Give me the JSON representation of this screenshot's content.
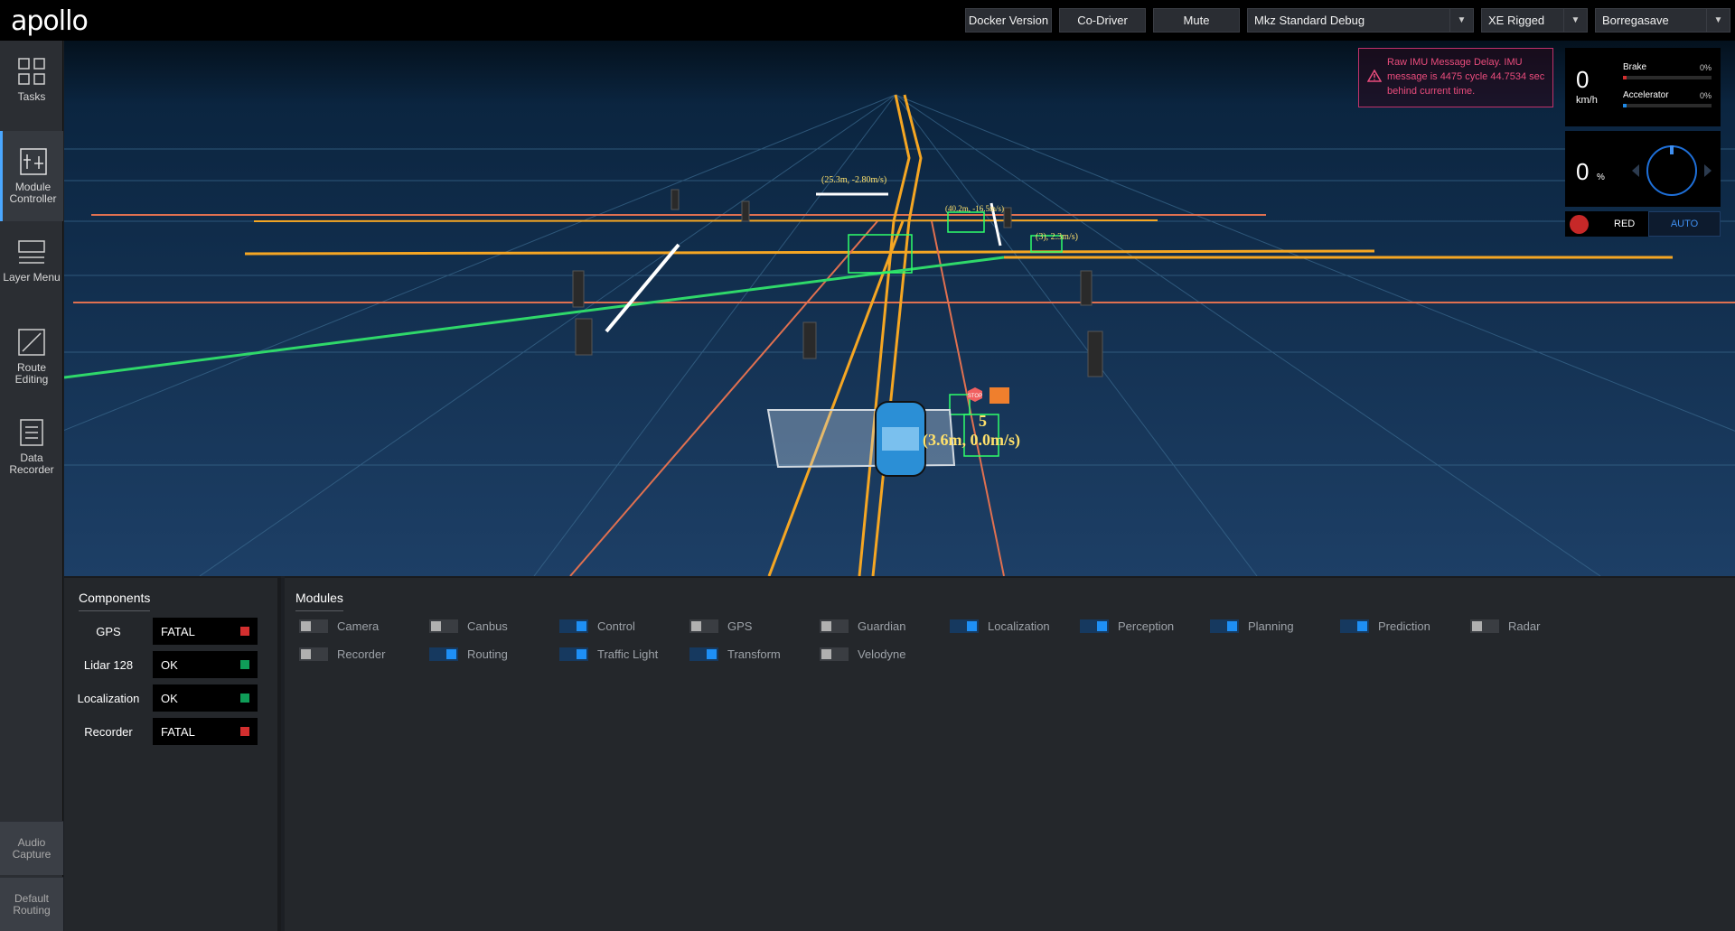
{
  "header": {
    "logo": "apollo",
    "buttons": [
      "Docker Version",
      "Co-Driver",
      "Mute"
    ],
    "vehicle_mode": "Mkz Standard Debug",
    "vehicle": "XE Rigged",
    "map": "Borregasave"
  },
  "sidebar": {
    "items": [
      {
        "label": "Tasks",
        "icon": "grid-icon"
      },
      {
        "label": "Module Controller",
        "icon": "module-controller-icon",
        "active": true
      },
      {
        "label": "Layer Menu",
        "icon": "layers-icon"
      },
      {
        "label": "Route Editing",
        "icon": "route-edit-icon"
      },
      {
        "label": "Data Recorder",
        "icon": "data-recorder-icon"
      }
    ],
    "bottom": [
      "Audio Capture",
      "Default Routing"
    ]
  },
  "alert": {
    "text": "Raw IMU Message Delay. IMU message is 4475 cycle 44.7534 sec behind current time.",
    "color": "#ea4c7c"
  },
  "dashboard": {
    "speed": "0",
    "speed_unit": "km/h",
    "brake_label": "Brake",
    "brake_pct": "0%",
    "accel_label": "Accelerator",
    "accel_pct": "0%",
    "steering": "0",
    "steering_unit": "%",
    "traffic_light": "RED",
    "driving_mode": "AUTO"
  },
  "scene": {
    "ego_label": "(3.6m, 0.0m/s)",
    "ego_id": "5",
    "stop_sign": "STOP",
    "obstacle_labels": [
      "(25.3m, -2.80m/s)",
      "(40.2m, -16.5m/s)",
      "(3), 2.3m/s)"
    ]
  },
  "components": {
    "title": "Components",
    "rows": [
      {
        "name": "GPS",
        "status": "FATAL",
        "color": "#d32f2f"
      },
      {
        "name": "Lidar 128",
        "status": "OK",
        "color": "#0f9d58"
      },
      {
        "name": "Localization",
        "status": "OK",
        "color": "#0f9d58"
      },
      {
        "name": "Recorder",
        "status": "FATAL",
        "color": "#d32f2f"
      }
    ]
  },
  "modules": {
    "title": "Modules",
    "items": [
      {
        "label": "Camera",
        "on": false
      },
      {
        "label": "Canbus",
        "on": false
      },
      {
        "label": "Control",
        "on": true
      },
      {
        "label": "GPS",
        "on": false
      },
      {
        "label": "Guardian",
        "on": false
      },
      {
        "label": "Localization",
        "on": true
      },
      {
        "label": "Perception",
        "on": true
      },
      {
        "label": "Planning",
        "on": true
      },
      {
        "label": "Prediction",
        "on": true
      },
      {
        "label": "Radar",
        "on": false
      },
      {
        "label": "Recorder",
        "on": false
      },
      {
        "label": "Routing",
        "on": true
      },
      {
        "label": "Traffic Light",
        "on": true
      },
      {
        "label": "Transform",
        "on": true
      },
      {
        "label": "Velodyne",
        "on": false
      }
    ]
  }
}
